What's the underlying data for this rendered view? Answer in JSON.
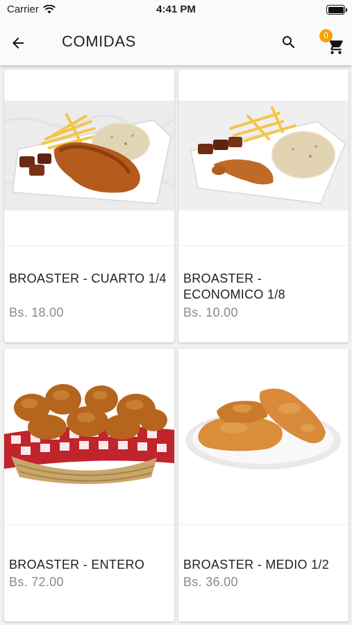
{
  "status_bar": {
    "carrier": "Carrier",
    "time": "4:41 PM"
  },
  "app_bar": {
    "title": "COMIDAS",
    "cart_count": "0"
  },
  "colors": {
    "badge": "#f5a100",
    "price": "#8a8a8a",
    "background": "#f1f1f1"
  },
  "icons": [
    "back-arrow-icon",
    "search-icon",
    "cart-icon",
    "wifi-icon",
    "battery-icon"
  ],
  "products": [
    {
      "name": "BROASTER - CUARTO 1/4",
      "price": "Bs. 18.00"
    },
    {
      "name": "BROASTER - ECONOMICO 1/8",
      "price": "Bs. 10.00"
    },
    {
      "name": "BROASTER - ENTERO",
      "price": "Bs. 72.00"
    },
    {
      "name": "BROASTER - MEDIO 1/2",
      "price": "Bs. 36.00"
    }
  ]
}
